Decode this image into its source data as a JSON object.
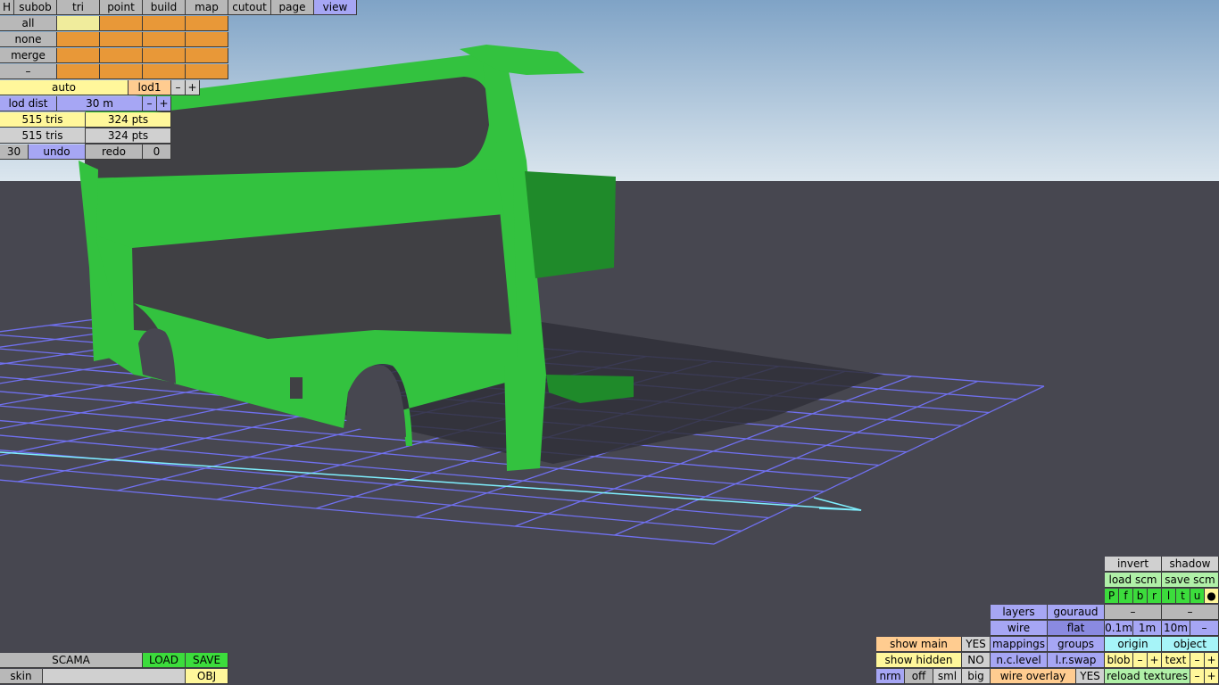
{
  "colors": {
    "sky_top": "#7fa3c6",
    "sky_bottom": "#dbe6ee",
    "ground": "#474750",
    "grid": "#7070f0",
    "axis": "#7ff0ff",
    "model": "#33c23f",
    "model_dark": "#1f8a2a",
    "window": "#404044"
  },
  "topbar": {
    "h": "H",
    "tabs": [
      "subob",
      "tri",
      "point",
      "build",
      "map",
      "cutout",
      "page",
      "view"
    ],
    "active_tab": "view"
  },
  "subob": {
    "rows": [
      "all",
      "none",
      "merge",
      "–"
    ]
  },
  "lod": {
    "auto": "auto",
    "lod1": "lod1",
    "minus": "–",
    "plus": "+",
    "dist_label": "lod dist",
    "dist_value": "30 m",
    "tris1": "515 tris",
    "pts1": "324 pts",
    "tris2": "515 tris",
    "pts2": "324 pts",
    "undo_count": "30",
    "undo": "undo",
    "redo": "redo",
    "redo_count": "0"
  },
  "bottom_left": {
    "name": "SCAMA",
    "load": "LOAD",
    "save": "SAVE",
    "skin": "skin",
    "skin_value": "",
    "obj": "OBJ"
  },
  "view_panel": {
    "invert": "invert",
    "shadow": "shadow",
    "load_scm": "load scm",
    "save_scm": "save scm",
    "flags": [
      "P",
      "f",
      "b",
      "r",
      "l",
      "t",
      "u",
      "●"
    ],
    "layers": "layers",
    "gouraud": "gouraud",
    "dash1": "–",
    "dash2": "–",
    "wire": "wire",
    "flat": "flat",
    "s01": "0.1m",
    "s1": "1m",
    "s10": "10m",
    "sminus": "–",
    "show_main": "show main",
    "show_main_val": "YES",
    "mappings": "mappings",
    "groups": "groups",
    "origin": "origin",
    "object": "object",
    "show_hidden": "show hidden",
    "show_hidden_val": "NO",
    "nclevel": "n.c.level",
    "lrswap": "l.r.swap",
    "blob": "blob",
    "blob_minus": "–",
    "blob_plus": "+",
    "text": "text",
    "text_minus": "–",
    "text_plus": "+",
    "nrm": "nrm",
    "off": "off",
    "sml": "sml",
    "big": "big",
    "wire_overlay": "wire overlay",
    "wire_overlay_val": "YES",
    "reload_textures": "reload textures",
    "rt_minus": "–",
    "rt_plus": "+"
  }
}
